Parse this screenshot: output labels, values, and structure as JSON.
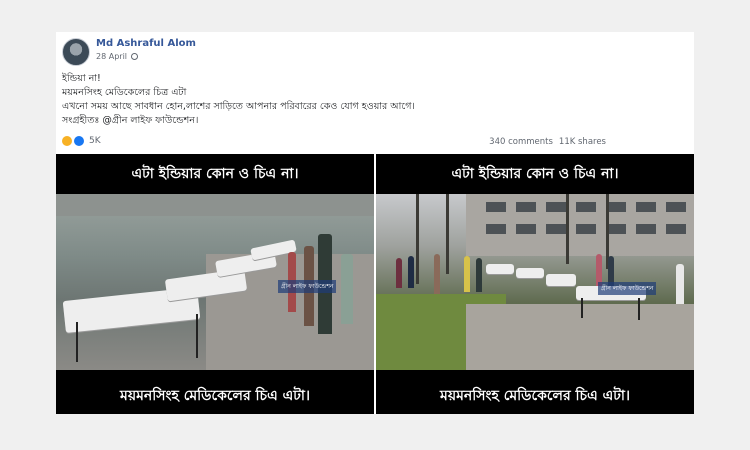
{
  "post": {
    "author": "Md Ashraful Alom",
    "date": "28 April",
    "lines": [
      "ইন্ডিয়া না!",
      "ময়মনসিংহ মেডিকেলের চিত্র এটা",
      "এখনো সময় আছে সাবধান হোন,লাশের সাড়িতে আপনার পরিবারের কেও যোগ হওয়ার আগে।",
      "সংগ্রহীতঃ @গ্রীন লাইফ ফাউন্ডেশন।"
    ],
    "reaction_count": "5K",
    "comments": "340 comments",
    "shares": "11K shares"
  },
  "images": [
    {
      "caption_top": "এটা ইন্ডিয়ার কোন ও চিএ না।",
      "caption_bottom": "ময়মনসিংহ মেডিকেলের চিএ এটা।",
      "watermark": "গ্রীন লাইফ ফাউন্ডেশন"
    },
    {
      "caption_top": "এটা ইন্ডিয়ার কোন ও চিএ না।",
      "caption_bottom": "ময়মনসিংহ মেডিকেলের চিএ এটা।",
      "watermark": "গ্রীন লাইফ ফাউন্ডেশন"
    }
  ],
  "icons": {
    "avatar": "profile-photo",
    "privacy": "globe-icon",
    "reactions": [
      "sad-icon",
      "like-icon"
    ]
  },
  "colors": {
    "author_link": "#365899",
    "like_blue": "#1877f2",
    "sad_yellow": "#f7b125"
  }
}
